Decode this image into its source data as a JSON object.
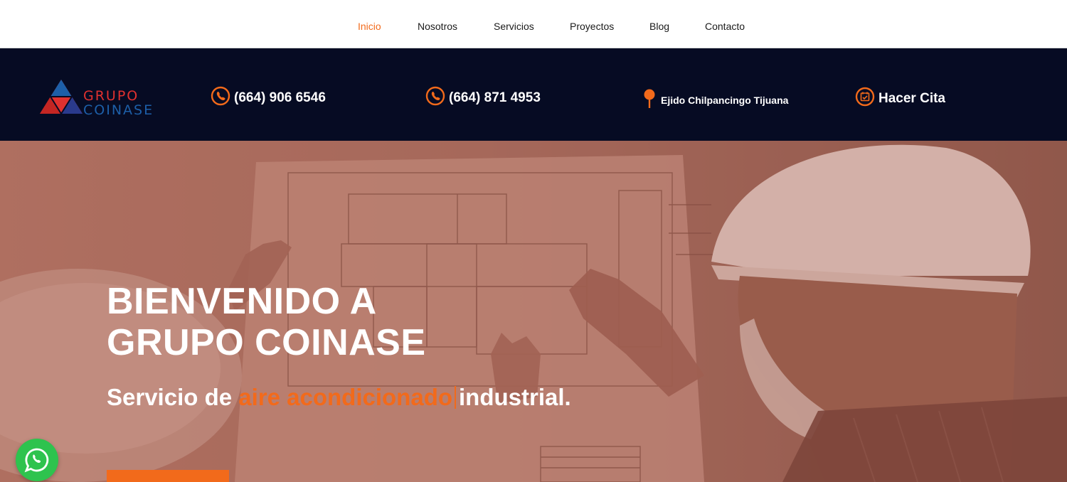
{
  "nav": {
    "items": [
      {
        "label": "Inicio",
        "active": true
      },
      {
        "label": "Nosotros",
        "active": false
      },
      {
        "label": "Servicios",
        "active": false
      },
      {
        "label": "Proyectos",
        "active": false
      },
      {
        "label": "Blog",
        "active": false
      },
      {
        "label": "Contacto",
        "active": false
      }
    ]
  },
  "brand": {
    "line1": "GRUPO",
    "line2": "COINASE",
    "colors": {
      "red": "#e0312f",
      "blue": "#1d5fa8"
    }
  },
  "contact": {
    "phone1": "(664) 906 6546",
    "phone2": "(664) 871 4953",
    "address": "Ejido Chilpancingo Tijuana",
    "appointment": "Hacer Cita",
    "icons": [
      "phone-icon",
      "phone-icon",
      "map-pin-icon",
      "calendar-icon"
    ]
  },
  "hero": {
    "title_line1": "BIENVENIDO A",
    "title_line2": "GRUPO COINASE",
    "subtitle_prefix": "Servicio de",
    "subtitle_highlight": "aire acondicionado",
    "subtitle_suffix": "industrial."
  },
  "floating": {
    "icon": "whatsapp-icon"
  },
  "colors": {
    "accent": "#f26a1b",
    "contact_bar_bg": "#060b23",
    "whatsapp": "#2ec34e"
  }
}
